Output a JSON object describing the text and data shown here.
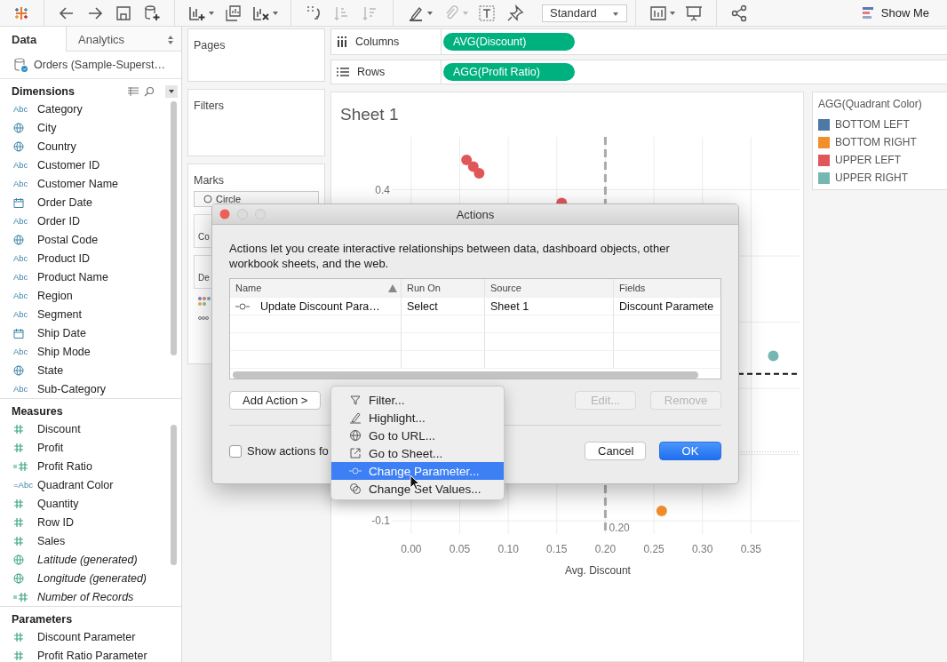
{
  "toolbar": {
    "fit": "Standard",
    "show_me": "Show Me"
  },
  "sidebar": {
    "tabs": [
      {
        "label": "Data",
        "selected": true
      },
      {
        "label": "Analytics",
        "selected": false
      }
    ],
    "data_source": "Orders (Sample-Superst…",
    "sections": [
      {
        "title": "Dimensions",
        "items": [
          {
            "kind": "string",
            "badge": "Abc",
            "name": "Category",
            "generated": false
          },
          {
            "kind": "geo",
            "name": "City",
            "generated": false
          },
          {
            "kind": "geo",
            "name": "Country",
            "generated": false
          },
          {
            "kind": "string",
            "badge": "Abc",
            "name": "Customer ID",
            "generated": false
          },
          {
            "kind": "string",
            "badge": "Abc",
            "name": "Customer Name",
            "generated": false
          },
          {
            "kind": "date",
            "name": "Order Date",
            "generated": false
          },
          {
            "kind": "string",
            "badge": "Abc",
            "name": "Order ID",
            "generated": false
          },
          {
            "kind": "geo",
            "name": "Postal Code",
            "generated": false
          },
          {
            "kind": "string",
            "badge": "Abc",
            "name": "Product ID",
            "generated": false
          },
          {
            "kind": "string",
            "badge": "Abc",
            "name": "Product Name",
            "generated": false
          },
          {
            "kind": "string",
            "badge": "Abc",
            "name": "Region",
            "generated": false
          },
          {
            "kind": "string",
            "badge": "Abc",
            "name": "Segment",
            "generated": false
          },
          {
            "kind": "date",
            "name": "Ship Date",
            "generated": false
          },
          {
            "kind": "string",
            "badge": "Abc",
            "name": "Ship Mode",
            "generated": false
          },
          {
            "kind": "geo",
            "name": "State",
            "generated": false
          },
          {
            "kind": "string",
            "badge": "Abc",
            "name": "Sub-Category",
            "generated": false
          }
        ]
      },
      {
        "title": "Measures",
        "items": [
          {
            "kind": "number",
            "name": "Discount",
            "generated": false
          },
          {
            "kind": "number",
            "name": "Profit",
            "generated": false
          },
          {
            "kind": "calc-number",
            "name": "Profit Ratio",
            "generated": false
          },
          {
            "kind": "calc-string",
            "badge": "=Abc",
            "name": "Quadrant Color",
            "generated": false
          },
          {
            "kind": "number",
            "name": "Quantity",
            "generated": false
          },
          {
            "kind": "number",
            "name": "Row ID",
            "generated": false
          },
          {
            "kind": "number",
            "name": "Sales",
            "generated": false
          },
          {
            "kind": "geo",
            "name": "Latitude (generated)",
            "generated": true
          },
          {
            "kind": "geo",
            "name": "Longitude (generated)",
            "generated": true
          },
          {
            "kind": "calc-number",
            "name": "Number of Records",
            "generated": true
          }
        ]
      },
      {
        "title": "Parameters",
        "items": [
          {
            "kind": "number",
            "name": "Discount Parameter",
            "generated": false
          },
          {
            "kind": "number",
            "name": "Profit Ratio Parameter",
            "generated": false
          }
        ]
      }
    ]
  },
  "cards": {
    "pages": "Pages",
    "filters": "Filters",
    "marks": {
      "title": "Marks",
      "mark_type": "Circle",
      "buttons": [
        "Co",
        "De"
      ]
    }
  },
  "shelves": [
    {
      "kind": "columns",
      "label": "Columns",
      "pills": [
        "AVG(Discount)"
      ]
    },
    {
      "kind": "rows",
      "label": "Rows",
      "pills": [
        "AGG(Profit Ratio)"
      ]
    }
  ],
  "view": {
    "title": "Sheet 1",
    "chart_data": {
      "type": "scatter",
      "xlabel": "Avg. Discount",
      "xticks": [
        {
          "value": 0,
          "label": "0.00"
        },
        {
          "value": 0.05,
          "label": "0.05"
        },
        {
          "value": 0.1,
          "label": "0.10"
        },
        {
          "value": 0.15,
          "label": "0.15"
        },
        {
          "value": 0.2,
          "label": "0.20"
        },
        {
          "value": 0.25,
          "label": "0.25"
        },
        {
          "value": 0.3,
          "label": "0.30"
        },
        {
          "value": 0.35,
          "label": "0.35"
        }
      ],
      "yticks": [
        0.4,
        -0.1
      ],
      "xlim": [
        -0.02,
        0.4
      ],
      "ylim": [
        -0.12,
        0.48
      ],
      "x": [
        0.057,
        0.064,
        0.07,
        0.155,
        0.258,
        0.373
      ],
      "series": [
        {
          "color": "#e15759",
          "values": [
            0.445,
            0.435,
            0.425,
            0.38,
            null,
            null
          ]
        },
        {
          "color": "#f28e2b",
          "values": [
            null,
            null,
            null,
            null,
            -0.085,
            null
          ]
        },
        {
          "color": "#76b7b2",
          "values": [
            null,
            null,
            null,
            null,
            null,
            0.149
          ]
        }
      ],
      "grid": true,
      "ref_lines": [
        {
          "axis": "x",
          "value": 0.2,
          "label": "0.20"
        },
        {
          "axis": "y",
          "value": 0.122
        },
        {
          "axis": "y",
          "value": 0.004
        }
      ]
    }
  },
  "legend": {
    "title": "AGG(Quadrant Color)",
    "items": [
      {
        "label": "BOTTOM LEFT",
        "color": "#4e79a7"
      },
      {
        "label": "BOTTOM RIGHT",
        "color": "#f28e2b"
      },
      {
        "label": "UPPER LEFT",
        "color": "#e15759"
      },
      {
        "label": "UPPER RIGHT",
        "color": "#76b7b2"
      }
    ]
  },
  "dialog": {
    "title": "Actions",
    "description": "Actions let you create interactive relationships between data, dashboard objects, other workbook sheets, and the web.",
    "table": {
      "columns": [
        {
          "label": "Name",
          "sorted": true
        },
        {
          "label": "Run On",
          "sorted": false
        },
        {
          "label": "Source",
          "sorted": false
        },
        {
          "label": "Fields",
          "sorted": false
        }
      ],
      "rows": [
        {
          "kind": "change-parameter",
          "cells": [
            "Update Discount Para…",
            "Select",
            "Sheet 1",
            "Discount Paramete"
          ]
        }
      ]
    },
    "add_button": "Add Action >",
    "edit_button": {
      "label": "Edit...",
      "disabled": true
    },
    "remove_button": {
      "label": "Remove",
      "disabled": true
    },
    "show_actions": {
      "label": "Show actions fo",
      "checked": false
    },
    "cancel": "Cancel",
    "ok": "OK"
  },
  "menu": {
    "items": [
      {
        "kind": "filter",
        "label": "Filter...",
        "selected": false
      },
      {
        "kind": "highlight",
        "label": "Highlight...",
        "selected": false
      },
      {
        "kind": "url",
        "label": "Go to URL...",
        "selected": false
      },
      {
        "kind": "sheet",
        "label": "Go to Sheet...",
        "selected": false
      },
      {
        "kind": "change-parameter",
        "label": "Change Parameter...",
        "selected": true
      },
      {
        "kind": "set-values",
        "label": "Change Set Values...",
        "selected": false
      }
    ]
  }
}
